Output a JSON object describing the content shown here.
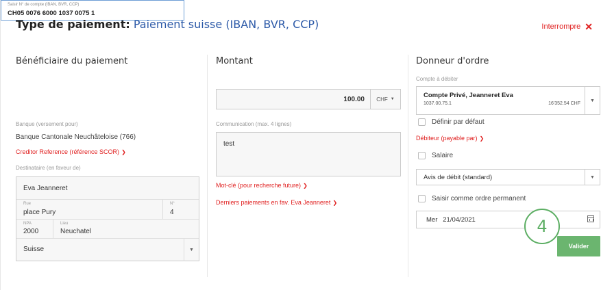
{
  "header": {
    "title_label": "Type de paiement:",
    "title_value": "Paiement suisse (IBAN, BVR, CCP)",
    "abort_label": "Interrompre",
    "abort_icon": "close-icon"
  },
  "beneficiary": {
    "heading": "Bénéficiaire du paiement",
    "account_placeholder": "Saisir N° de compte (IBAN, BVR, CCP)",
    "account_value": "CH05 0076 6000 1037 0075 1",
    "bank_label": "Banque (versement pour)",
    "bank_value": "Banque Cantonale Neuchâteloise (766)",
    "creditor_ref_link": "Creditor Reference (référence SCOR)",
    "recipient_label": "Destinataire (en faveur de)",
    "name": "Eva Jeanneret",
    "street_label": "Rue",
    "street_value": "place Pury",
    "number_label": "N°",
    "number_value": "4",
    "npa_label": "NPA",
    "npa_value": "2000",
    "city_label": "Lieu",
    "city_value": "Neuchatel",
    "country_value": "Suisse"
  },
  "amount": {
    "heading": "Montant",
    "value": "100.00",
    "currency": "CHF",
    "communication_label": "Communication (max. 4 lignes)",
    "communication_value": "test",
    "keyword_link": "Mot-clé (pour recherche future)",
    "last_payments_link": "Derniers paiements en fav. Eva Jeanneret"
  },
  "orderer": {
    "heading": "Donneur d'ordre",
    "debit_account_label": "Compte à débiter",
    "account_name": "Compte Privé, Jeanneret Eva",
    "account_number": "1037.00.75.1",
    "account_balance": "16'352.54 CHF",
    "default_checkbox_label": "Définir par défaut",
    "debtor_link": "Débiteur (payable par)",
    "salary_checkbox_label": "Salaire",
    "debit_notice_value": "Avis de débit (standard)",
    "standing_order_label": "Saisir comme ordre permanent",
    "date_value": "Mer   21/04/2021",
    "validate_label": "Valider",
    "step_number": "4"
  }
}
